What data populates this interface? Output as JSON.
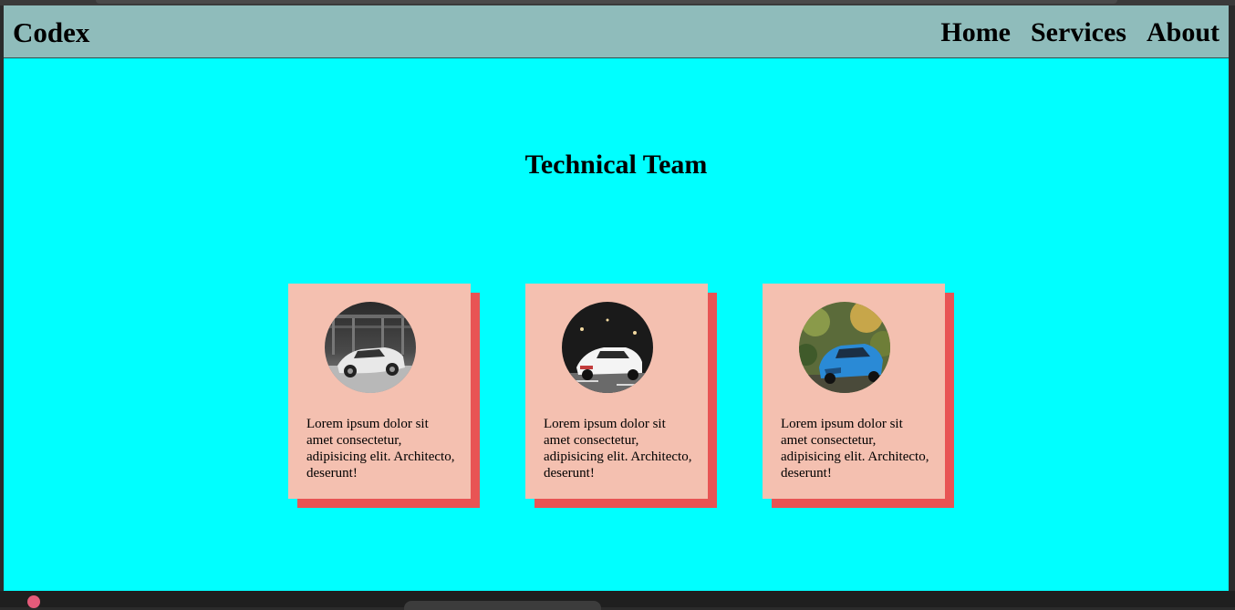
{
  "navbar": {
    "brand": "Codex",
    "links": [
      "Home",
      "Services",
      "About"
    ]
  },
  "section": {
    "title": "Technical Team"
  },
  "cards": [
    {
      "image": "car-photo-white-sports-car",
      "text": "Lorem ipsum dolor sit amet consectetur, adipisicing elit. Architecto, deserunt!"
    },
    {
      "image": "car-photo-white-car-night",
      "text": "Lorem ipsum dolor sit amet consectetur, adipisicing elit. Architecto, deserunt!"
    },
    {
      "image": "car-photo-blue-car-forest",
      "text": "Lorem ipsum dolor sit amet consectetur, adipisicing elit. Architecto, deserunt!"
    }
  ],
  "colors": {
    "page_background": "#00ffff",
    "navbar_background": "#8fbcbb",
    "card_background": "#f4c0b0",
    "card_shadow": "#e85454"
  }
}
